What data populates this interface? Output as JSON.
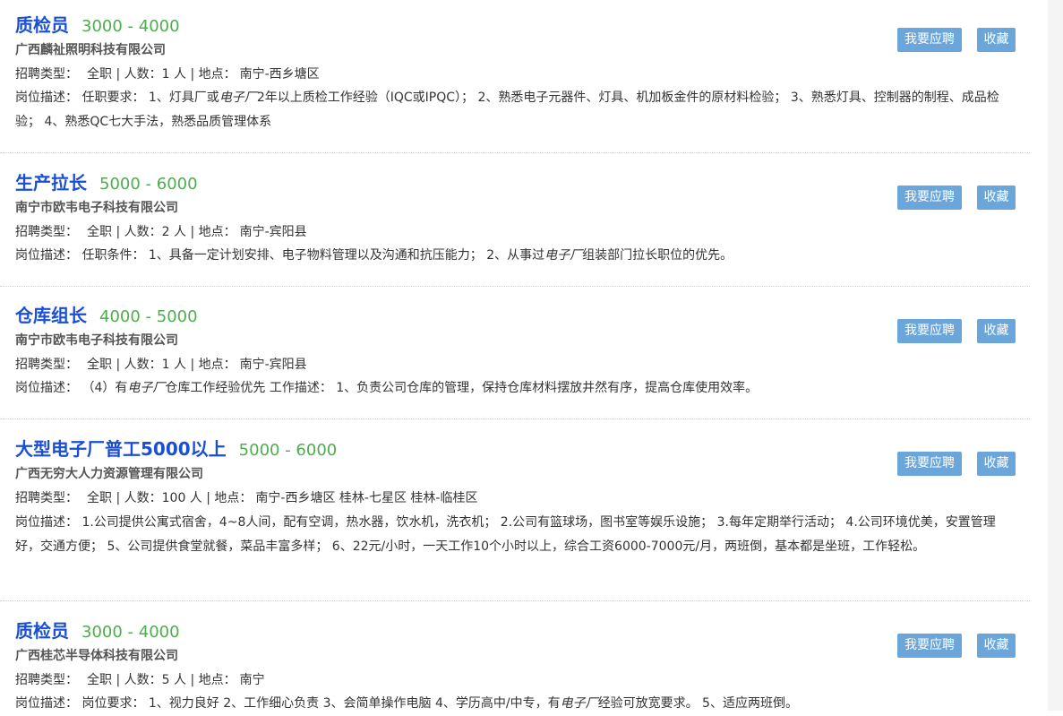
{
  "labels": {
    "type": "招聘类型：",
    "count": "人数：",
    "location": "地点：",
    "desc": "岗位描述：",
    "apply": "我要应聘",
    "save": "收藏",
    "sep": "|"
  },
  "jobs": [
    {
      "title": "质检员",
      "salary": "3000 - 4000",
      "company": "广西麟祉照明科技有限公司",
      "type": "全职",
      "count": "1 人",
      "location": "南宁-西乡塘区",
      "desc": [
        "任职要求： 1、灯具厂或",
        "电子厂",
        "2年以上质检工作经验（IQC或IPQC）； 2、熟悉电子元器件、灯具、机加板金件的原材料检验； 3、熟悉灯具、控制器的制程、成品检验； 4、熟悉QC七大手法，熟悉品质管理体系"
      ]
    },
    {
      "title": "生产拉长",
      "salary": "5000 - 6000",
      "company": "南宁市欧韦电子科技有限公司",
      "type": "全职",
      "count": "2 人",
      "location": "南宁-宾阳县",
      "desc": [
        "任职条件： 1、具备一定计划安排、电子物料管理以及沟通和抗压能力； 2、从事过",
        "电子厂",
        "组装部门拉长职位的优先。"
      ]
    },
    {
      "title": "仓库组长",
      "salary": "4000 - 5000",
      "company": "南宁市欧韦电子科技有限公司",
      "type": "全职",
      "count": "1 人",
      "location": "南宁-宾阳县",
      "desc": [
        "（4）有",
        "电子厂",
        "仓库工作经验优先 工作描述： 1、负责公司仓库的管理，保持仓库材料摆放井然有序，提高仓库使用效率。"
      ]
    },
    {
      "title": "大型电子厂普工5000以上",
      "salary": "5000 - 6000",
      "company": "广西无穷大人力资源管理有限公司",
      "type": "全职",
      "count": "100 人",
      "location": "南宁-西乡塘区 桂林-七星区 桂林-临桂区",
      "desc": [
        "1.公司提供公寓式宿舍，4~8人间，配有空调，热水器，饮水机，洗衣机； 2.公司有篮球场，图书室等娱乐设施； 3.每年定期举行活动； 4.公司环境优美，安置管理好，交通方便； 5、公司提供食堂就餐，菜品丰富多样； 6、22元/小时，一天工作10个小时以上，综合工资6000-7000元/月，两班倒，基本都是坐班，工作轻松。",
        "",
        ""
      ]
    },
    {
      "title": "质检员",
      "salary": "3000 - 4000",
      "company": "广西桂芯半导体科技有限公司",
      "type": "全职",
      "count": "5 人",
      "location": "南宁",
      "desc": [
        "岗位要求： 1、视力良好 2、工作细心负责 3、会简单操作电脑 4、学历高中/中专，有",
        "电子厂",
        "经验可放宽要求。 5、适应两班倒。"
      ]
    }
  ]
}
